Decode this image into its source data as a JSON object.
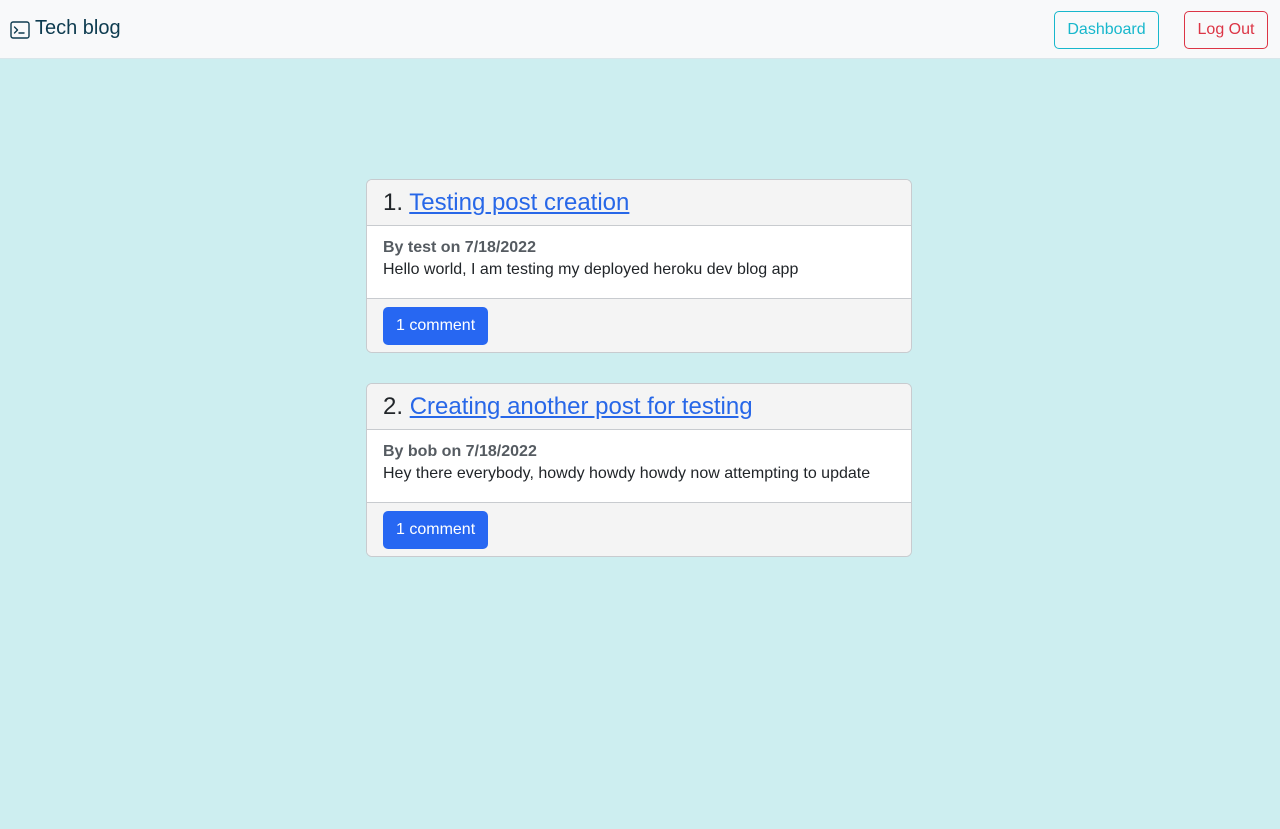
{
  "navbar": {
    "brand_icon": "terminal-icon",
    "brand_label": "Tech blog",
    "dashboard_label": "Dashboard",
    "logout_label": "Log Out"
  },
  "posts": [
    {
      "number": "1.",
      "title": "Testing post creation",
      "meta": "By test on 7/18/2022",
      "content": "Hello world, I am testing my deployed heroku dev blog app",
      "comments_label": "1 comment"
    },
    {
      "number": "2.",
      "title": "Creating another post for testing",
      "meta": "By bob on 7/18/2022",
      "content": "Hey there everybody, howdy howdy howdy now attempting to update",
      "comments_label": "1 comment"
    }
  ],
  "colors": {
    "page_background": "#cdeef0",
    "dashboard_accent": "#17b7cc",
    "logout_accent": "#dc3545",
    "link": "#2767e8",
    "primary_button": "#2767f2"
  }
}
